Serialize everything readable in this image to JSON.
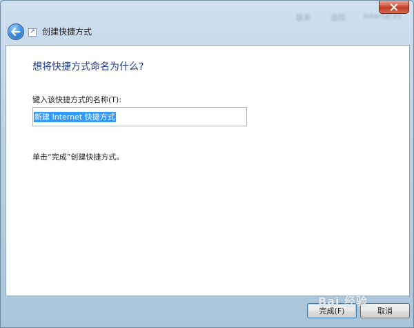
{
  "window": {
    "title": "创建快捷方式",
    "background_ghost_text": [
      "联系",
      "追踪",
      "Interfaces"
    ]
  },
  "page": {
    "heading": "想将快捷方式命名为什么?",
    "field_label": "键入该快捷方式的名称(T):",
    "name_value": "新建 Internet 快捷方式",
    "hint": "单击“完成”创建快捷方式。"
  },
  "buttons": {
    "finish_label": "完成(F)",
    "cancel_label": "取消"
  },
  "watermark": "Bai 经验",
  "colors": {
    "heading": "#1e3a8a",
    "selection": "#3399ff",
    "close": "#c23a22"
  }
}
